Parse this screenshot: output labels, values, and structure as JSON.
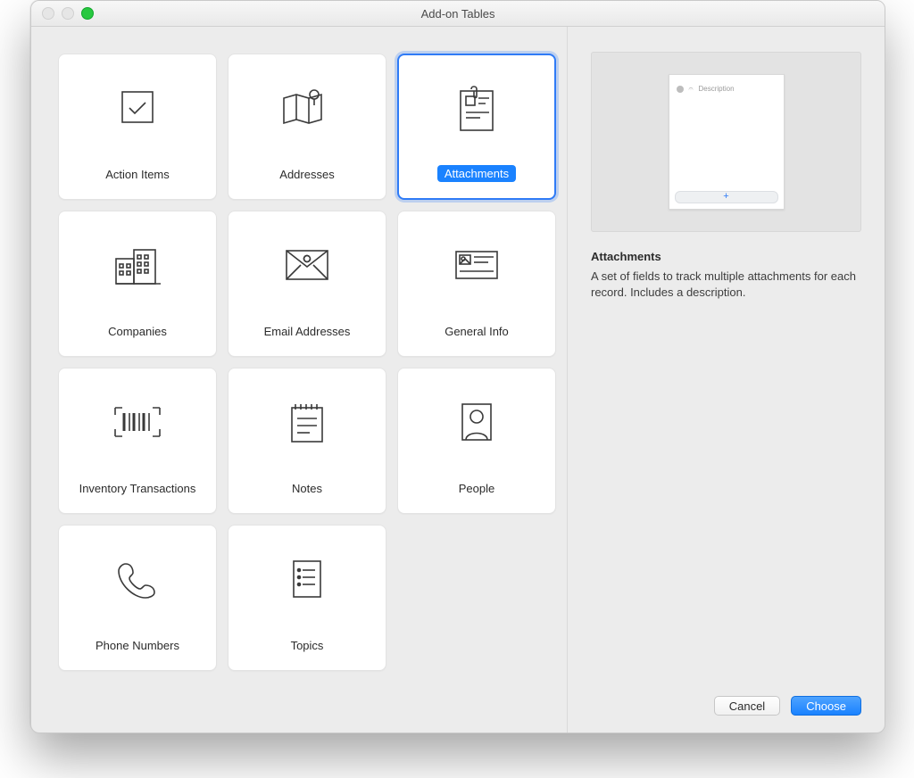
{
  "window": {
    "title": "Add-on Tables"
  },
  "grid": {
    "selected_index": 2,
    "items": [
      {
        "label": "Action Items",
        "icon": "checkbox-icon"
      },
      {
        "label": "Addresses",
        "icon": "map-pin-icon"
      },
      {
        "label": "Attachments",
        "icon": "attachment-doc-icon"
      },
      {
        "label": "Companies",
        "icon": "buildings-icon"
      },
      {
        "label": "Email Addresses",
        "icon": "envelope-at-icon"
      },
      {
        "label": "General Info",
        "icon": "card-lines-icon"
      },
      {
        "label": "Inventory Transactions",
        "icon": "barcode-icon"
      },
      {
        "label": "Notes",
        "icon": "notepad-icon"
      },
      {
        "label": "People",
        "icon": "person-frame-icon"
      },
      {
        "label": "Phone Numbers",
        "icon": "phone-handset-icon"
      },
      {
        "label": "Topics",
        "icon": "list-doc-icon"
      }
    ]
  },
  "detail": {
    "title": "Attachments",
    "description": "A set of fields to track multiple attachments for each record. Includes a description.",
    "preview": {
      "column": "Description",
      "add": "+"
    }
  },
  "footer": {
    "cancel": "Cancel",
    "choose": "Choose"
  },
  "colors": {
    "accent": "#1a82ff",
    "selection_border": "#2f7bf6"
  }
}
